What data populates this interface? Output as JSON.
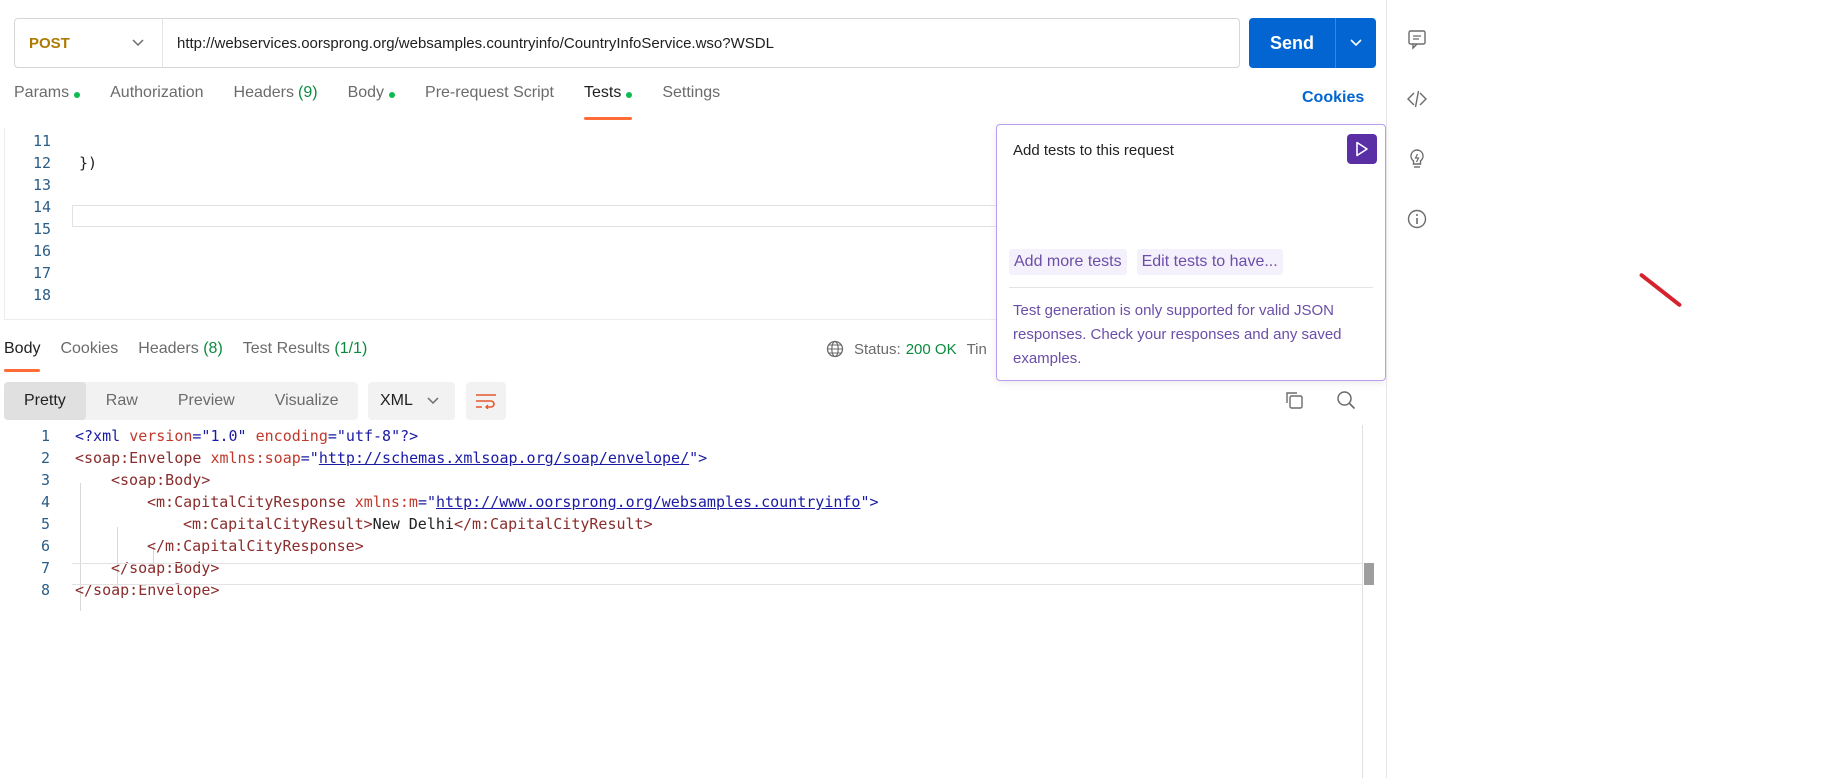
{
  "request": {
    "method": "POST",
    "url": "http://webservices.oorsprong.org/websamples.countryinfo/CountryInfoService.wso?WSDL",
    "send_label": "Send"
  },
  "request_tabs": [
    {
      "label": "Params",
      "dot": true
    },
    {
      "label": "Authorization"
    },
    {
      "label": "Headers",
      "count": "(9)"
    },
    {
      "label": "Body",
      "dot": true
    },
    {
      "label": "Pre-request Script"
    },
    {
      "label": "Tests",
      "dot": true,
      "active": true
    },
    {
      "label": "Settings"
    }
  ],
  "cookies_label": "Cookies",
  "editor": {
    "lines": [
      {
        "n": "11",
        "text": ""
      },
      {
        "n": "12",
        "text": "})"
      },
      {
        "n": "13",
        "text": ""
      },
      {
        "n": "14",
        "text": ""
      },
      {
        "n": "15",
        "text": ""
      },
      {
        "n": "16",
        "text": ""
      },
      {
        "n": "17",
        "text": ""
      },
      {
        "n": "18",
        "text": ""
      }
    ]
  },
  "response_tabs": [
    {
      "label": "Body",
      "active": true
    },
    {
      "label": "Cookies"
    },
    {
      "label": "Headers",
      "count": "(8)"
    },
    {
      "label": "Test Results",
      "count": "(1/1)"
    }
  ],
  "status": {
    "label": "Status:",
    "value": "200 OK",
    "extra": "Tin"
  },
  "view_modes": [
    "Pretty",
    "Raw",
    "Preview",
    "Visualize"
  ],
  "format": "XML",
  "response_lines": [
    {
      "n": "1"
    },
    {
      "n": "2"
    },
    {
      "n": "3"
    },
    {
      "n": "4"
    },
    {
      "n": "5"
    },
    {
      "n": "6"
    },
    {
      "n": "7"
    },
    {
      "n": "8"
    }
  ],
  "xml": {
    "l1_a": "<?xml ",
    "l1_b": "version",
    "l1_c": "=\"1.0\" ",
    "l1_d": "encoding",
    "l1_e": "=\"utf-8\"",
    "l1_f": "?>",
    "l2_a": "<soap:Envelope ",
    "l2_b": "xmlns:soap",
    "l2_c": "=\"",
    "l2_d": "http://schemas.xmlsoap.org/soap/envelope/",
    "l2_e": "\">",
    "l3": "<soap:Body>",
    "l4_a": "<m:CapitalCityResponse ",
    "l4_b": "xmlns:m",
    "l4_c": "=\"",
    "l4_d": "http://www.oorsprong.org/websamples.countryinfo",
    "l4_e": "\">",
    "l5_a": "<m:CapitalCityResult>",
    "l5_b": "New Delhi",
    "l5_c": "</m:CapitalCityResult>",
    "l6": "</m:CapitalCityResponse>",
    "l7_a": "</",
    "l7_b": "soap:Body",
    "l7_c": ">",
    "l8": "</soap:Envelope>"
  },
  "popup": {
    "placeholder": "Add tests to this request",
    "chips": [
      "Add more tests",
      "Edit tests to have..."
    ],
    "note": "Test generation is only supported for valid JSON responses. Check your responses and any saved examples."
  },
  "rail_icons": [
    "comment-icon",
    "code-icon",
    "lightbulb-icon",
    "info-icon"
  ],
  "colors": {
    "accent": "#ff6c37",
    "send": "#0265d2",
    "ok": "#0b8a3e",
    "ai": "#5a2fa6"
  }
}
